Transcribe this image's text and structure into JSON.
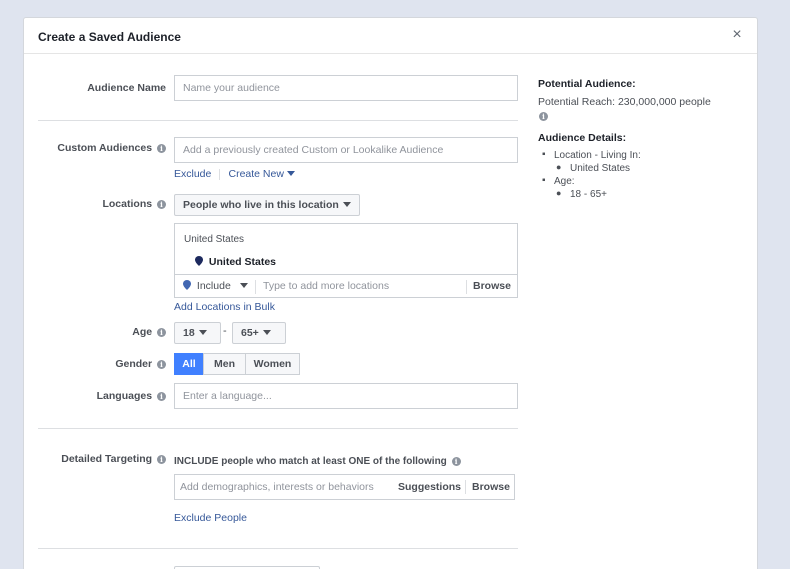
{
  "dialog": {
    "title": "Create a Saved Audience",
    "close_glyph": "×"
  },
  "audience_name": {
    "label": "Audience Name",
    "placeholder": "Name your audience"
  },
  "custom_audiences": {
    "label": "Custom Audiences",
    "placeholder": "Add a previously created Custom or Lookalike Audience",
    "exclude": "Exclude",
    "create_new": "Create New"
  },
  "locations": {
    "label": "Locations",
    "dropdown": "People who live in this location",
    "group_header": "United States",
    "selected": "United States",
    "include": "Include",
    "placeholder": "Type to add more locations",
    "browse": "Browse",
    "bulk": "Add Locations in Bulk"
  },
  "age": {
    "label": "Age",
    "min": "18",
    "dash": "-",
    "max": "65+"
  },
  "gender": {
    "label": "Gender",
    "options": [
      "All",
      "Men",
      "Women"
    ],
    "selected": "All"
  },
  "languages": {
    "label": "Languages",
    "placeholder": "Enter a language..."
  },
  "detailed_targeting": {
    "label": "Detailed Targeting",
    "include_text": "INCLUDE people who match at least ONE of the following",
    "placeholder": "Add demographics, interests or behaviors",
    "suggestions": "Suggestions",
    "browse": "Browse",
    "exclude": "Exclude People"
  },
  "sidebar": {
    "potential_heading": "Potential Audience:",
    "reach": "Potential Reach: 230,000,000 people",
    "details_heading": "Audience Details:",
    "location_item": "Location - Living In:",
    "location_value": "United States",
    "age_item": "Age:",
    "age_value": "18 - 65+"
  },
  "colors": {
    "accent": "#4080ff",
    "link": "#365899",
    "background": "#dfe4ef"
  }
}
